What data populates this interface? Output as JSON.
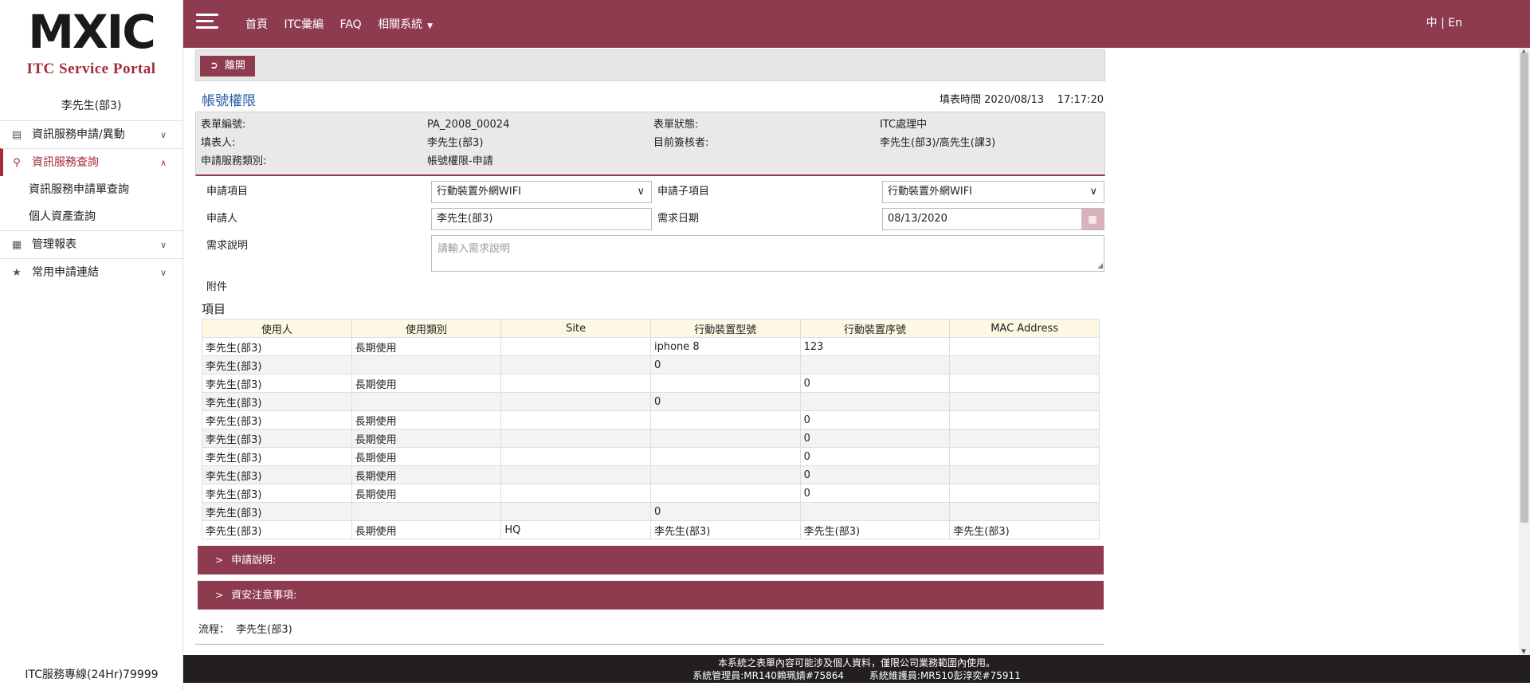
{
  "sidebar": {
    "logo_text": "MXIC",
    "portal_title": "ITC Service Portal",
    "user": "李先生(部3)",
    "items": [
      {
        "label": "資訊服務申請/異動",
        "icon": "document-icon"
      },
      {
        "label": "資訊服務查詢",
        "icon": "search-icon"
      },
      {
        "label": "管理報表",
        "icon": "table-icon"
      },
      {
        "label": "常用申請連結",
        "icon": "star-icon"
      }
    ],
    "subitems": [
      "資訊服務申請單查詢",
      "個人資產查詢"
    ],
    "hotline": "ITC服務專線(24Hr)79999"
  },
  "topbar": {
    "nav": [
      "首頁",
      "ITC彙編",
      "FAQ",
      "相關系統"
    ],
    "lang": "中 | En"
  },
  "main": {
    "leave_label": "離開",
    "title": "帳號權限",
    "fill_time_label": "填表時間",
    "fill_date": "2020/08/13",
    "fill_time": "17:17:20",
    "info": {
      "form_no_label": "表單編號:",
      "form_no": "PA_2008_00024",
      "form_status_label": "表單狀態:",
      "form_status": "ITC處理中",
      "filler_label": "填表人:",
      "filler": "李先生(部3)",
      "reviewer_label": "目前簽核者:",
      "reviewer": "李先生(部3)/高先生(課3)",
      "category_label": "申請服務類別:",
      "category": "帳號權限-申請"
    },
    "form": {
      "item_label": "申請項目",
      "item_value": "行動裝置外網WIFI",
      "subitem_label": "申請子項目",
      "subitem_value": "行動裝置外網WIFI",
      "applicant_label": "申請人",
      "applicant_value": "李先生(部3)",
      "date_label": "需求日期",
      "date_value": "08/13/2020",
      "desc_label": "需求說明",
      "desc_placeholder": "請輸入需求說明",
      "attach_label": "附件"
    },
    "items_title": "項目",
    "table": {
      "headers": [
        "使用人",
        "使用類別",
        "Site",
        "行動裝置型號",
        "行動裝置序號",
        "MAC Address"
      ],
      "rows": [
        [
          "李先生(部3)",
          "長期使用",
          "",
          "iphone 8",
          "123",
          ""
        ],
        [
          "李先生(部3)",
          "",
          "",
          "0",
          "",
          ""
        ],
        [
          "李先生(部3)",
          "長期使用",
          "",
          "",
          "0",
          ""
        ],
        [
          "李先生(部3)",
          "",
          "",
          "0",
          "",
          ""
        ],
        [
          "李先生(部3)",
          "長期使用",
          "",
          "",
          "0",
          ""
        ],
        [
          "李先生(部3)",
          "長期使用",
          "",
          "",
          "0",
          ""
        ],
        [
          "李先生(部3)",
          "長期使用",
          "",
          "",
          "0",
          ""
        ],
        [
          "李先生(部3)",
          "長期使用",
          "",
          "",
          "0",
          ""
        ],
        [
          "李先生(部3)",
          "長期使用",
          "",
          "",
          "0",
          ""
        ],
        [
          "李先生(部3)",
          "",
          "",
          "0",
          "",
          ""
        ],
        [
          "李先生(部3)",
          "長期使用",
          "HQ",
          "李先生(部3)",
          "李先生(部3)",
          "李先生(部3)"
        ]
      ]
    },
    "panels": [
      "申請說明:",
      "資安注意事項:"
    ],
    "flow_label": "流程：",
    "flow_value": "李先生(部3)"
  },
  "footer": {
    "line1": "本系統之表單內容可能涉及個人資料，僅限公司業務範圍內使用。",
    "admin": "系統管理員:MR140賴珮婧#75864",
    "maintainer": "系統維護員:MR510彭淳奕#75911"
  },
  "colors": {
    "brand": "#8e3a4f",
    "title_blue": "#2a5ea8"
  }
}
